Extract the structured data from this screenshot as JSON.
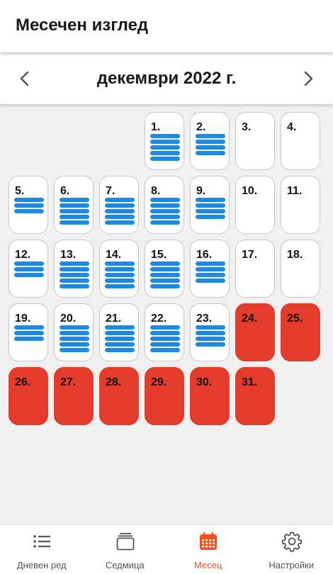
{
  "app_title": "Месечен изглед",
  "month_label": "декември 2022 г.",
  "colors": {
    "accent": "#f4511e",
    "holiday": "#e33b2c",
    "event_bar": "#1a8ae6"
  },
  "days": [
    {
      "label": "1.",
      "bars": 5,
      "holiday": false
    },
    {
      "label": "2.",
      "bars": 4,
      "holiday": false
    },
    {
      "label": "3.",
      "bars": 0,
      "holiday": false
    },
    {
      "label": "4.",
      "bars": 0,
      "holiday": false
    },
    {
      "label": "5.",
      "bars": 3,
      "holiday": false
    },
    {
      "label": "6.",
      "bars": 5,
      "holiday": false
    },
    {
      "label": "7.",
      "bars": 5,
      "holiday": false
    },
    {
      "label": "8.",
      "bars": 5,
      "holiday": false
    },
    {
      "label": "9.",
      "bars": 4,
      "holiday": false
    },
    {
      "label": "10.",
      "bars": 0,
      "holiday": false
    },
    {
      "label": "11.",
      "bars": 0,
      "holiday": false
    },
    {
      "label": "12.",
      "bars": 3,
      "holiday": false
    },
    {
      "label": "13.",
      "bars": 5,
      "holiday": false
    },
    {
      "label": "14.",
      "bars": 5,
      "holiday": false
    },
    {
      "label": "15.",
      "bars": 5,
      "holiday": false
    },
    {
      "label": "16.",
      "bars": 4,
      "holiday": false
    },
    {
      "label": "17.",
      "bars": 0,
      "holiday": false
    },
    {
      "label": "18.",
      "bars": 0,
      "holiday": false
    },
    {
      "label": "19.",
      "bars": 3,
      "holiday": false
    },
    {
      "label": "20.",
      "bars": 5,
      "holiday": false
    },
    {
      "label": "21.",
      "bars": 5,
      "holiday": false
    },
    {
      "label": "22.",
      "bars": 5,
      "holiday": false
    },
    {
      "label": "23.",
      "bars": 4,
      "holiday": false
    },
    {
      "label": "24.",
      "bars": 0,
      "holiday": true
    },
    {
      "label": "25.",
      "bars": 0,
      "holiday": true
    },
    {
      "label": "26.",
      "bars": 0,
      "holiday": true
    },
    {
      "label": "27.",
      "bars": 0,
      "holiday": true
    },
    {
      "label": "28.",
      "bars": 0,
      "holiday": true
    },
    {
      "label": "29.",
      "bars": 0,
      "holiday": true
    },
    {
      "label": "30.",
      "bars": 0,
      "holiday": true
    },
    {
      "label": "31.",
      "bars": 0,
      "holiday": true
    }
  ],
  "bottom_nav": [
    {
      "label": "Дневен ред",
      "icon": "list-icon",
      "active": false
    },
    {
      "label": "Седмица",
      "icon": "week-stack-icon",
      "active": false
    },
    {
      "label": "Месец",
      "icon": "calendar-month-icon",
      "active": true
    },
    {
      "label": "Настройки",
      "icon": "gear-icon",
      "active": false
    }
  ]
}
